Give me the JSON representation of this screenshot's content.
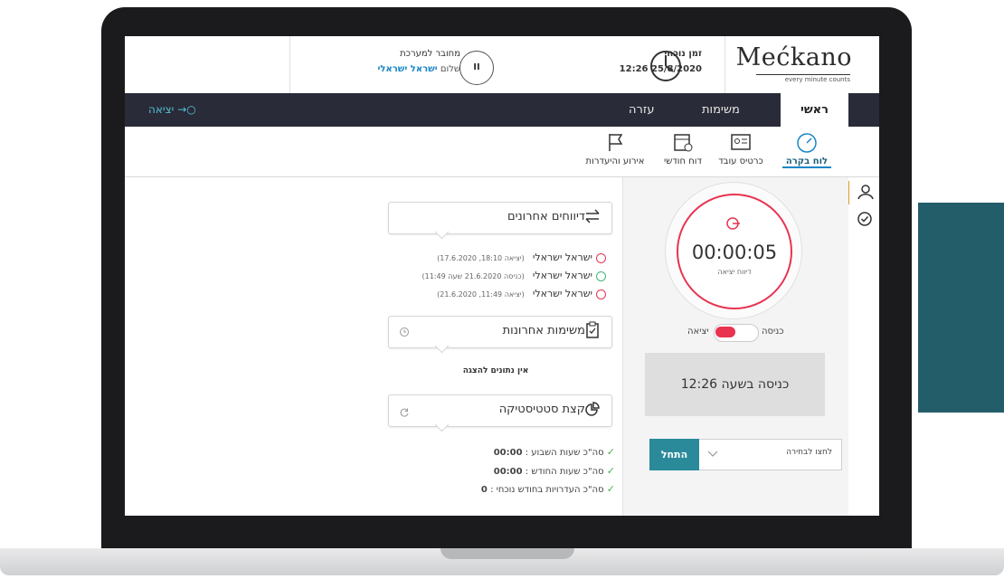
{
  "brand": {
    "name": "Mećkano",
    "tagline": "every minute counts"
  },
  "header": {
    "time_label": "זמן נוכחי",
    "time_value": "12:26 25/8/2020",
    "pause_glyph": "II",
    "connected_label": "מחובר למערכת",
    "greeting_prefix": "שלום",
    "user_name": "ישראל ישראלי"
  },
  "nav": {
    "home": "ראשי",
    "tasks": "משימות",
    "help": "עזרה",
    "logout": "יציאה"
  },
  "subnav": {
    "dashboard": "לוח בקרה",
    "employee_card": "כרטיס עובד",
    "monthly_report": "דוח חודשי",
    "events": "אירוע והיעדרות"
  },
  "recent_reports": {
    "title": "דיווחים אחרונים",
    "rows": [
      {
        "name": "ישראל ישראלי",
        "detail": "(יציאה 18:10, 17.6.2020)",
        "type": "exit"
      },
      {
        "name": "ישראל ישראלי",
        "detail": "(כניסה 21.6.2020 שעה 11:49)",
        "type": "entry"
      },
      {
        "name": "ישראל ישראלי",
        "detail": "(יציאה 11:49, 21.6.2020)",
        "type": "exit"
      }
    ]
  },
  "recent_tasks": {
    "title": "משימות אחרונות",
    "empty": "אין נתונים להצגה"
  },
  "stats": {
    "title": "קצת סטטיסטיקה",
    "week_label": "סה\"כ שעות השבוע :",
    "week_value": "00:00",
    "month_label": "סה\"כ שעות החודש :",
    "month_value": "00:00",
    "absence_label": "סה\"כ העדרויות בחודש נוכחי :",
    "absence_value": "0"
  },
  "timer": {
    "value": "00:00:05",
    "sub": "דיווח יציאה"
  },
  "toggle": {
    "in": "כניסה",
    "out": "יציאה"
  },
  "status_text": "כניסה בשעה 12:26",
  "select": {
    "placeholder": "לחצו לבחירה",
    "start": "התחל"
  },
  "colors": {
    "accent_red": "#e83351",
    "teal": "#2b8a9a",
    "nav_bg": "#2a2b38",
    "link_blue": "#1a86c7"
  }
}
